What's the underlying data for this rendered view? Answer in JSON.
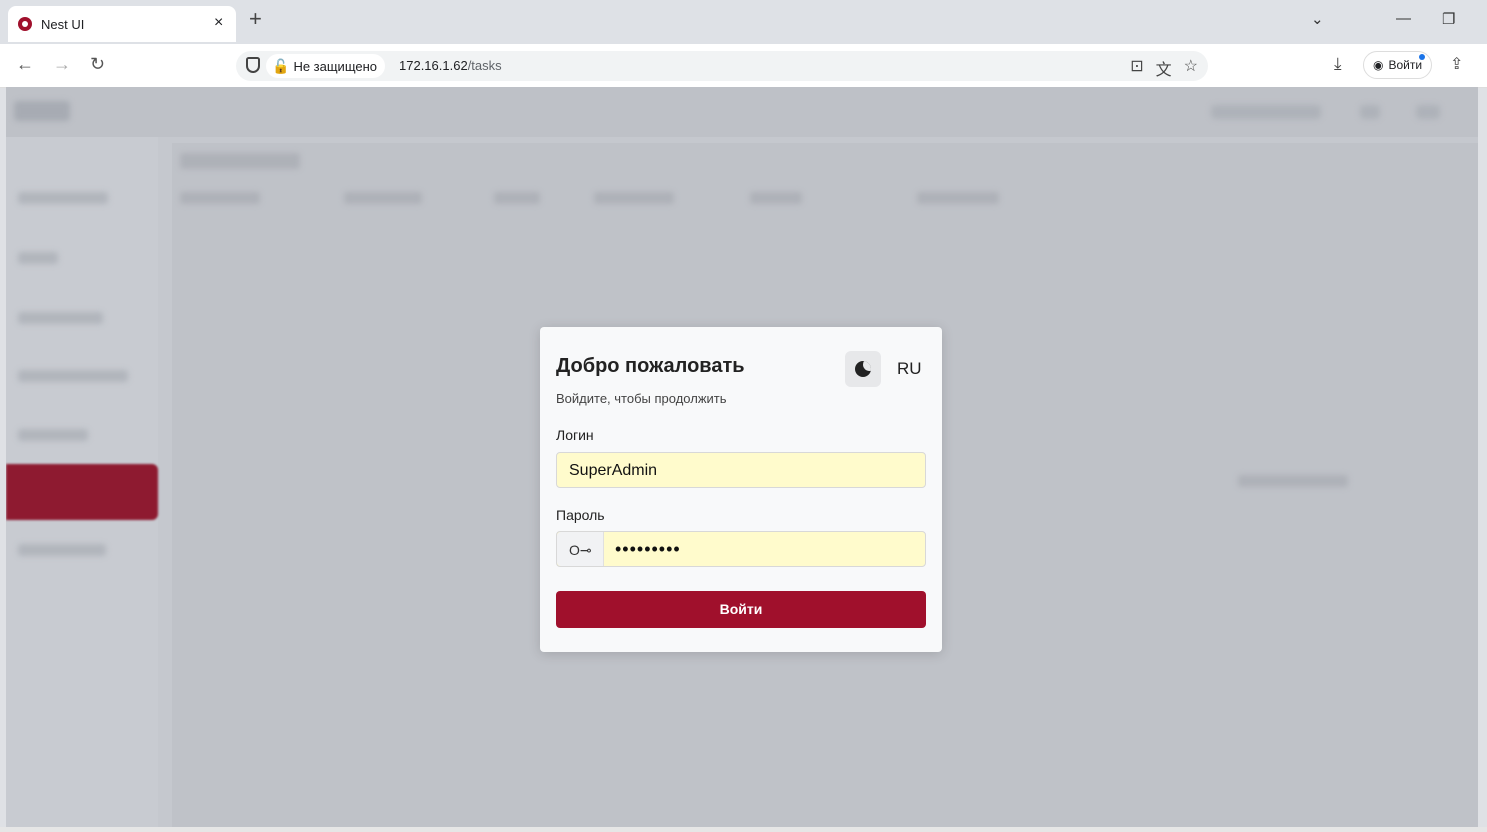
{
  "browser": {
    "tab_title": "Nest UI",
    "tab_close": "×",
    "new_tab": "+",
    "security_label": "Не защищено",
    "url_host": "172.16.1.62",
    "url_path": "/tasks",
    "profile_label": "Войти",
    "nav": {
      "back": "←",
      "forward": "→",
      "reload": "↻"
    },
    "window": {
      "menu": "⌄",
      "minimize": "—",
      "restore": "❐"
    }
  },
  "login": {
    "title": "Добро пожаловать",
    "subtitle": "Войдите, чтобы продолжить",
    "language": "RU",
    "username_label": "Логин",
    "username_value": "SuperAdmin",
    "password_label": "Пароль",
    "password_mask": "•••••••••",
    "submit_label": "Войти"
  },
  "colors": {
    "accent": "#a0102c",
    "autofill": "#fffbcc"
  }
}
